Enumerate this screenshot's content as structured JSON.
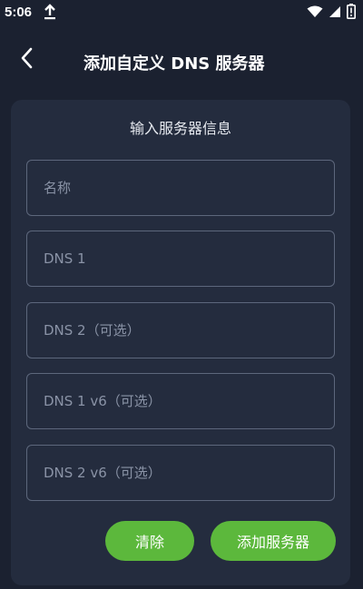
{
  "status_bar": {
    "time": "5:06"
  },
  "app_bar": {
    "title": "添加自定义 DNS 服务器"
  },
  "form": {
    "title": "输入服务器信息",
    "fields": [
      {
        "placeholder": "名称",
        "value": ""
      },
      {
        "placeholder": "DNS 1",
        "value": ""
      },
      {
        "placeholder": "DNS 2（可选）",
        "value": ""
      },
      {
        "placeholder": "DNS 1 v6（可选）",
        "value": ""
      },
      {
        "placeholder": "DNS 2 v6（可选）",
        "value": ""
      }
    ],
    "clear_label": "清除",
    "add_label": "添加服务器"
  },
  "colors": {
    "background": "#1b2130",
    "card": "#242c3e",
    "accent_green": "#5cb83c",
    "field_border": "#5d677c",
    "placeholder": "#8a93a6"
  },
  "icons": {
    "status_upload": "upload-arrow-icon",
    "wifi": "wifi-icon",
    "signal": "cell-signal-icon",
    "battery": "battery-alert-icon",
    "back": "back-arrow-icon"
  }
}
